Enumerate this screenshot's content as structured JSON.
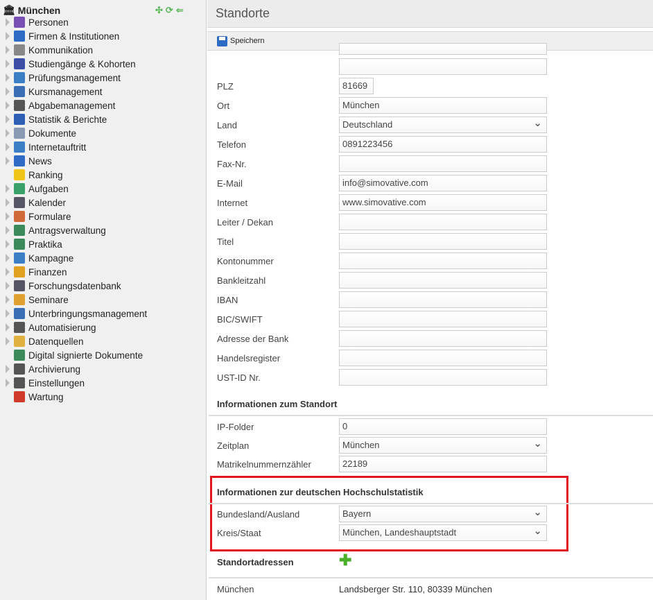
{
  "sidebar": {
    "root": "München",
    "items": [
      {
        "label": "Personen",
        "icon": "persons-icon",
        "color": "#7a4fb5",
        "expand": true
      },
      {
        "label": "Firmen & Institutionen",
        "icon": "factory-icon",
        "color": "#2d6bc4",
        "expand": true
      },
      {
        "label": "Kommunikation",
        "icon": "envelope-icon",
        "color": "#888",
        "expand": true
      },
      {
        "label": "Studiengänge & Kohorten",
        "icon": "graduation-icon",
        "color": "#3a4fa5",
        "expand": true
      },
      {
        "label": "Prüfungsmanagement",
        "icon": "checklist-icon",
        "color": "#3a7fc4",
        "expand": true
      },
      {
        "label": "Kursmanagement",
        "icon": "book-icon",
        "color": "#3a6fb5",
        "expand": true
      },
      {
        "label": "Abgabemanagement",
        "icon": "id-card-icon",
        "color": "#555",
        "expand": true
      },
      {
        "label": "Statistik & Berichte",
        "icon": "bar-chart-icon",
        "color": "#2d5fb5",
        "expand": true
      },
      {
        "label": "Dokumente",
        "icon": "folder-icon",
        "color": "#8a9ab5",
        "expand": true
      },
      {
        "label": "Internetauftritt",
        "icon": "globe-icon",
        "color": "#3a7fc4",
        "expand": true
      },
      {
        "label": "News",
        "icon": "info-icon",
        "color": "#2d6bc4",
        "expand": true
      },
      {
        "label": "Ranking",
        "icon": "star-icon",
        "color": "#f0c419",
        "expand": false
      },
      {
        "label": "Aufgaben",
        "icon": "history-icon",
        "color": "#3aa06a",
        "expand": true
      },
      {
        "label": "Kalender",
        "icon": "calendar-icon",
        "color": "#556",
        "expand": true
      },
      {
        "label": "Formulare",
        "icon": "form-icon",
        "color": "#d06a3a",
        "expand": true
      },
      {
        "label": "Antragsverwaltung",
        "icon": "table-icon",
        "color": "#3a8a5a",
        "expand": true
      },
      {
        "label": "Praktika",
        "icon": "table-icon",
        "color": "#3a8a5a",
        "expand": true
      },
      {
        "label": "Kampagne",
        "icon": "gift-icon",
        "color": "#3a7fc4",
        "expand": true
      },
      {
        "label": "Finanzen",
        "icon": "coins-icon",
        "color": "#e0a020",
        "expand": true
      },
      {
        "label": "Forschungsdatenbank",
        "icon": "line-chart-icon",
        "color": "#556",
        "expand": true
      },
      {
        "label": "Seminare",
        "icon": "briefcase-icon",
        "color": "#e0a030",
        "expand": true
      },
      {
        "label": "Unterbringungsmanagement",
        "icon": "building-icon",
        "color": "#3a6fb5",
        "expand": true
      },
      {
        "label": "Automatisierung",
        "icon": "gear-icon",
        "color": "#555",
        "expand": true
      },
      {
        "label": "Datenquellen",
        "icon": "database-icon",
        "color": "#e0b040",
        "expand": true
      },
      {
        "label": "Digital signierte Dokumente",
        "icon": "signed-document-icon",
        "color": "#3a8a5a",
        "expand": false
      },
      {
        "label": "Archivierung",
        "icon": "id-card-icon",
        "color": "#555",
        "expand": true
      },
      {
        "label": "Einstellungen",
        "icon": "gear-icon",
        "color": "#555",
        "expand": true
      },
      {
        "label": "Wartung",
        "icon": "first-aid-icon",
        "color": "#d03a2a",
        "expand": false
      }
    ]
  },
  "main": {
    "title": "Standorte",
    "save_label": "Speichern",
    "fields": [
      {
        "label": "PLZ",
        "value": "81669",
        "short": true
      },
      {
        "label": "Ort",
        "value": "München"
      },
      {
        "label": "Land",
        "value": "Deutschland",
        "select": true
      },
      {
        "label": "Telefon",
        "value": "0891223456"
      },
      {
        "label": "Fax-Nr.",
        "value": ""
      },
      {
        "label": "E-Mail",
        "value": "info@simovative.com"
      },
      {
        "label": "Internet",
        "value": "www.simovative.com"
      },
      {
        "label": "Leiter / Dekan",
        "value": ""
      },
      {
        "label": "Titel",
        "value": ""
      },
      {
        "label": "Kontonummer",
        "value": ""
      },
      {
        "label": "Bankleitzahl",
        "value": ""
      },
      {
        "label": "IBAN",
        "value": ""
      },
      {
        "label": "BIC/SWIFT",
        "value": ""
      },
      {
        "label": "Adresse der Bank",
        "value": ""
      },
      {
        "label": "Handelsregister",
        "value": ""
      },
      {
        "label": "UST-ID Nr.",
        "value": ""
      }
    ],
    "section_standort": "Informationen zum Standort",
    "standort_fields": [
      {
        "label": "IP-Folder",
        "value": "0"
      },
      {
        "label": "Zeitplan",
        "value": "München",
        "select": true
      },
      {
        "label": "Matrikelnummernzähler",
        "value": "22189"
      }
    ],
    "section_statistik": "Informationen zur deutschen Hochschulstatistik",
    "statistik_fields": [
      {
        "label": "Bundesland/Ausland",
        "value": "Bayern",
        "select": true
      },
      {
        "label": "Kreis/Staat",
        "value": "München, Landeshauptstadt",
        "select": true
      }
    ],
    "section_adressen": "Standortadressen",
    "address": {
      "name": "München",
      "value": "Landsberger Str. 110, 80339 München"
    },
    "highlight_color": "#e3161e"
  }
}
